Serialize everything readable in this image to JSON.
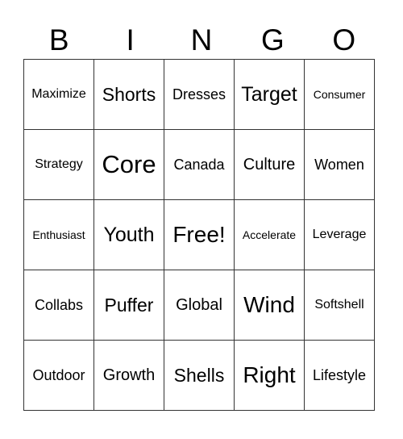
{
  "header": {
    "letters": [
      "B",
      "I",
      "N",
      "G",
      "O"
    ]
  },
  "grid": {
    "rows": [
      [
        "Maximize",
        "Shorts",
        "Dresses",
        "Target",
        "Consumer"
      ],
      [
        "Strategy",
        "Core",
        "Canada",
        "Culture",
        "Women"
      ],
      [
        "Enthusiast",
        "Youth",
        "Free!",
        "Accelerate",
        "Leverage"
      ],
      [
        "Collabs",
        "Puffer",
        "Global",
        "Wind",
        "Softshell"
      ],
      [
        "Outdoor",
        "Growth",
        "Shells",
        "Right",
        "Lifestyle"
      ]
    ]
  }
}
